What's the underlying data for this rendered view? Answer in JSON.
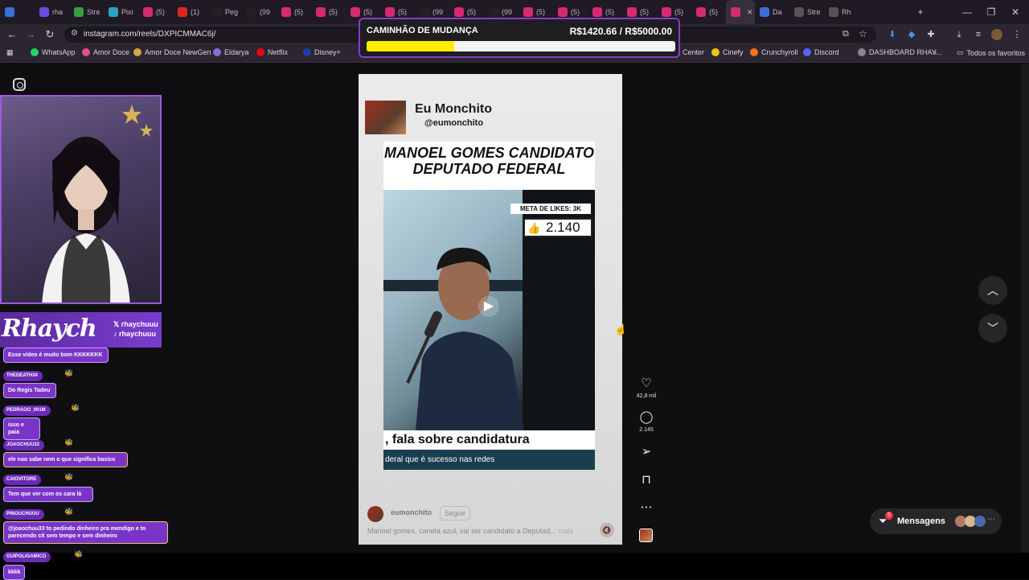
{
  "browser": {
    "tabs": [
      {
        "icon_color": "#3b6fd9",
        "label": ""
      },
      {
        "icon_color": "#6b4cd6",
        "label": "rha"
      },
      {
        "icon_color": "#3a9f3a",
        "label": "Stre"
      },
      {
        "icon_color": "#2ea2c2",
        "label": "Pixi"
      },
      {
        "icon_color": "#d62976",
        "label": "(5)"
      },
      {
        "icon_color": "#e02424",
        "label": "(1)"
      },
      {
        "icon_color": "#222222",
        "label": "Peg"
      },
      {
        "icon_color": "#222222",
        "label": "(99"
      },
      {
        "icon_color": "#d62976",
        "label": "(5)"
      },
      {
        "icon_color": "#d62976",
        "label": "(5)"
      },
      {
        "icon_color": "#d62976",
        "label": "(5)"
      },
      {
        "icon_color": "#d62976",
        "label": "(5)"
      },
      {
        "icon_color": "#222222",
        "label": "(99"
      },
      {
        "icon_color": "#d62976",
        "label": "(5)"
      },
      {
        "icon_color": "#222222",
        "label": "(99"
      },
      {
        "icon_color": "#d62976",
        "label": "(5)"
      },
      {
        "icon_color": "#d62976",
        "label": "(5)"
      },
      {
        "icon_color": "#d62976",
        "label": "(5)"
      },
      {
        "icon_color": "#d62976",
        "label": "(5)"
      },
      {
        "icon_color": "#d62976",
        "label": "(5)"
      },
      {
        "icon_color": "#d62976",
        "label": "(5)"
      },
      {
        "icon_color": "#d62976",
        "label": "",
        "active": true
      },
      {
        "icon_color": "#3b6fd9",
        "label": "Da"
      },
      {
        "icon_color": "#555555",
        "label": "Stre"
      },
      {
        "icon_color": "#555555",
        "label": "Rh"
      }
    ],
    "url": "instagram.com/reels/DXPICMMAC6j/",
    "bookmarks": [
      {
        "label": "WhatsApp",
        "color": "#25d366"
      },
      {
        "label": "Amor Doce",
        "color": "#e0528a"
      },
      {
        "label": "Amor Doce NewGen",
        "color": "#d6a34a"
      },
      {
        "label": "Eldarya",
        "color": "#8a6ad6"
      },
      {
        "label": "Netflix",
        "color": "#e50914"
      },
      {
        "label": "Disney+",
        "color": "#1a3fa6"
      },
      {
        "label": "Yo",
        "color": "#ff0000"
      }
    ],
    "bookmarks_right": [
      {
        "label": "Center",
        "color": ""
      },
      {
        "label": "Cinefy",
        "color": "#f0c419"
      },
      {
        "label": "Crunchyroll",
        "color": "#f47521"
      },
      {
        "label": "Discord",
        "color": "#5865f2"
      },
      {
        "label": "DASHBOARD RHAY...",
        "color": "#888888"
      }
    ],
    "all_bookmarks": "Todos os favoritos"
  },
  "goal": {
    "title": "CAMINHÃO DE MUDANÇA",
    "amount": "R$1420.66 / R$5000.00",
    "progress": 0.284
  },
  "stream": {
    "brand": "Rhaych",
    "handles": [
      "rhaychuuu",
      "rhaychuuu"
    ],
    "chat": [
      {
        "user": "",
        "message": "Esse vídeo é muito bom KKKKKKK"
      },
      {
        "user": "THEDEATH34",
        "message": "Do Regis Tadeu"
      },
      {
        "user": "PEDRAOO_001M",
        "message": "isso e paia"
      },
      {
        "user": "JOAOCHUU33",
        "message": "ele nao sabe nem o que significa basico"
      },
      {
        "user": "CAIOVITORE",
        "message": "Tem que ver com os cara lá"
      },
      {
        "user": "PINGUCHUUU",
        "message": "@joaochuu33 to pedindo dinheiro pra mendigo e to parecendo cit sem tempo e sem dinheiro"
      },
      {
        "user": "GUIPOLIGAMICO",
        "message": "kkkk"
      }
    ]
  },
  "reel": {
    "author_name": "Eu Monchito",
    "author_handle": "@eumonchito",
    "headline": "MANOEL GOMES CANDIDATO DEPUTADO FEDERAL",
    "likes_goal": "META DE LIKES: 3K",
    "likes_count": "2.140",
    "caption_1": ", fala sobre candidatura",
    "caption_2": "deral que é sucesso nas redes",
    "footer_user": "eumonchito",
    "follow_label": "Seguir",
    "description": "Manoel gomes, caneta azul, vai ser candidato a Deputad...",
    "more_label": "mais"
  },
  "actions": {
    "likes": "42,8 mil",
    "comments": "2.145"
  },
  "messages": {
    "label": "Mensagens",
    "badge": "5"
  },
  "icons": [
    "instagram-icon",
    "heart-icon",
    "comment-icon",
    "share-icon",
    "bookmark-icon",
    "more-icon",
    "chevron-up-icon",
    "chevron-down-icon",
    "mute-icon",
    "play-icon",
    "messages-icon"
  ]
}
